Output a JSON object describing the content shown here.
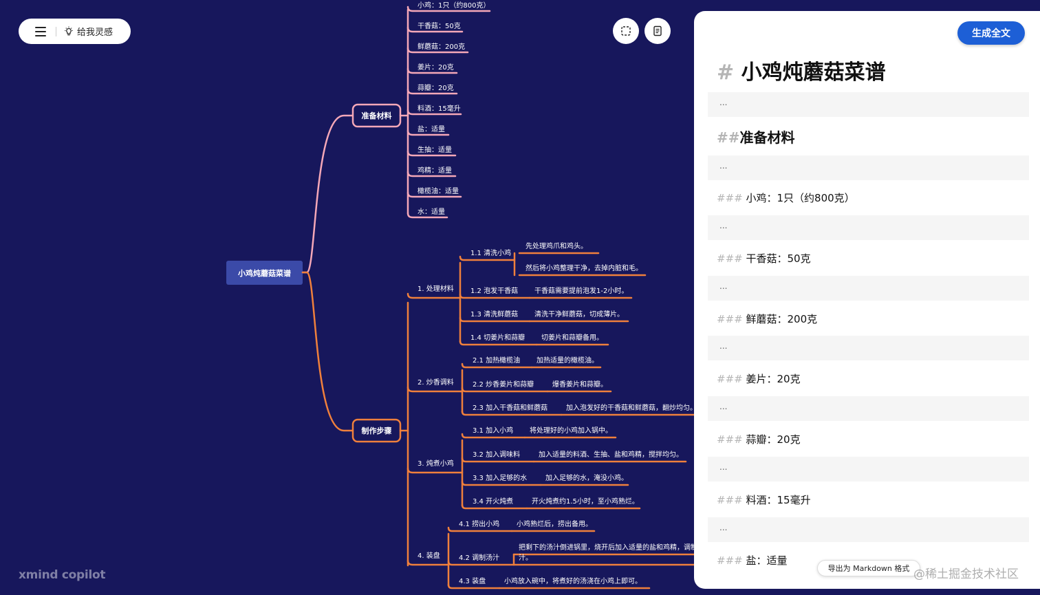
{
  "toolbar": {
    "inspire_label": "给我灵感"
  },
  "logo": "xmind copilot",
  "mindmap": {
    "root": "小鸡炖蘑菇菜谱",
    "branch1": {
      "label": "准备材料",
      "items": [
        "小鸡：1只（约800克）",
        "干香菇：50克",
        "鲜蘑菇：200克",
        "姜片：20克",
        "蒜瓣：20克",
        "料酒：15毫升",
        "盐：适量",
        "生抽：适量",
        "鸡精：适量",
        "橄榄油：适量",
        "水：适量"
      ]
    },
    "branch2": {
      "label": "制作步骤",
      "steps": [
        {
          "label": "1. 处理材料",
          "subs": [
            {
              "label": "1.1 清洗小鸡",
              "details": [
                "先处理鸡爪和鸡头。",
                "然后将小鸡整理干净，去掉内脏和毛。"
              ]
            },
            {
              "label": "1.2 泡发干香菇",
              "details": [
                "干香菇需要提前泡发1-2小时。"
              ]
            },
            {
              "label": "1.3 清洗鲜蘑菇",
              "details": [
                "清洗干净鲜蘑菇，切成薄片。"
              ]
            },
            {
              "label": "1.4 切姜片和蒜瓣",
              "details": [
                "切姜片和蒜瓣备用。"
              ]
            }
          ]
        },
        {
          "label": "2. 炒香调料",
          "subs": [
            {
              "label": "2.1 加热橄榄油",
              "details": [
                "加热适量的橄榄油。"
              ]
            },
            {
              "label": "2.2 炒香姜片和蒜瓣",
              "details": [
                "爆香姜片和蒜瓣。"
              ]
            },
            {
              "label": "2.3 加入干香菇和鲜蘑菇",
              "details": [
                "加入泡发好的干香菇和鲜蘑菇，翻炒均匀。"
              ]
            }
          ]
        },
        {
          "label": "3. 炖煮小鸡",
          "subs": [
            {
              "label": "3.1 加入小鸡",
              "details": [
                "将处理好的小鸡加入锅中。"
              ]
            },
            {
              "label": "3.2 加入调味料",
              "details": [
                "加入适量的料酒、生抽、盐和鸡精，搅拌均匀。"
              ]
            },
            {
              "label": "3.3 加入足够的水",
              "details": [
                "加入足够的水，淹没小鸡。"
              ]
            },
            {
              "label": "3.4 开火炖煮",
              "details": [
                "开火炖煮约1.5小时，至小鸡熟烂。"
              ]
            }
          ]
        },
        {
          "label": "4. 装盘",
          "subs": [
            {
              "label": "4.1 捞出小鸡",
              "details": [
                "小鸡熟烂后，捞出备用。"
              ]
            },
            {
              "label": "4.2 调制汤汁",
              "details": [
                "把剩下的汤汁倒进锅里，烧开后加入适量的盐和鸡精，调制",
                "汁。"
              ]
            },
            {
              "label": "4.3 装盘",
              "details": [
                "小鸡放入碗中，将煮好的汤浇在小鸡上即可。"
              ]
            }
          ]
        }
      ]
    }
  },
  "panel": {
    "generate_label": "生成全文",
    "h1_hash": "#",
    "h1": "小鸡炖蘑菇菜谱",
    "h2_hash": "##",
    "h2": "准备材料",
    "h3_hash": "###",
    "placeholder": "...",
    "h3_items": [
      "小鸡：1只（约800克）",
      "干香菇：50克",
      "鲜蘑菇：200克",
      "姜片：20克",
      "蒜瓣：20克",
      "料酒：15毫升",
      "盐：适量"
    ],
    "export_label": "导出为 Markdown 格式"
  },
  "watermark": "@稀土掘金技术社区",
  "colors": {
    "background": "#17175c",
    "branch_pink": "#f5a8b8",
    "branch_orange": "#f0803c",
    "root_fill": "#3b4aa8",
    "accent": "#1d5fd6"
  }
}
